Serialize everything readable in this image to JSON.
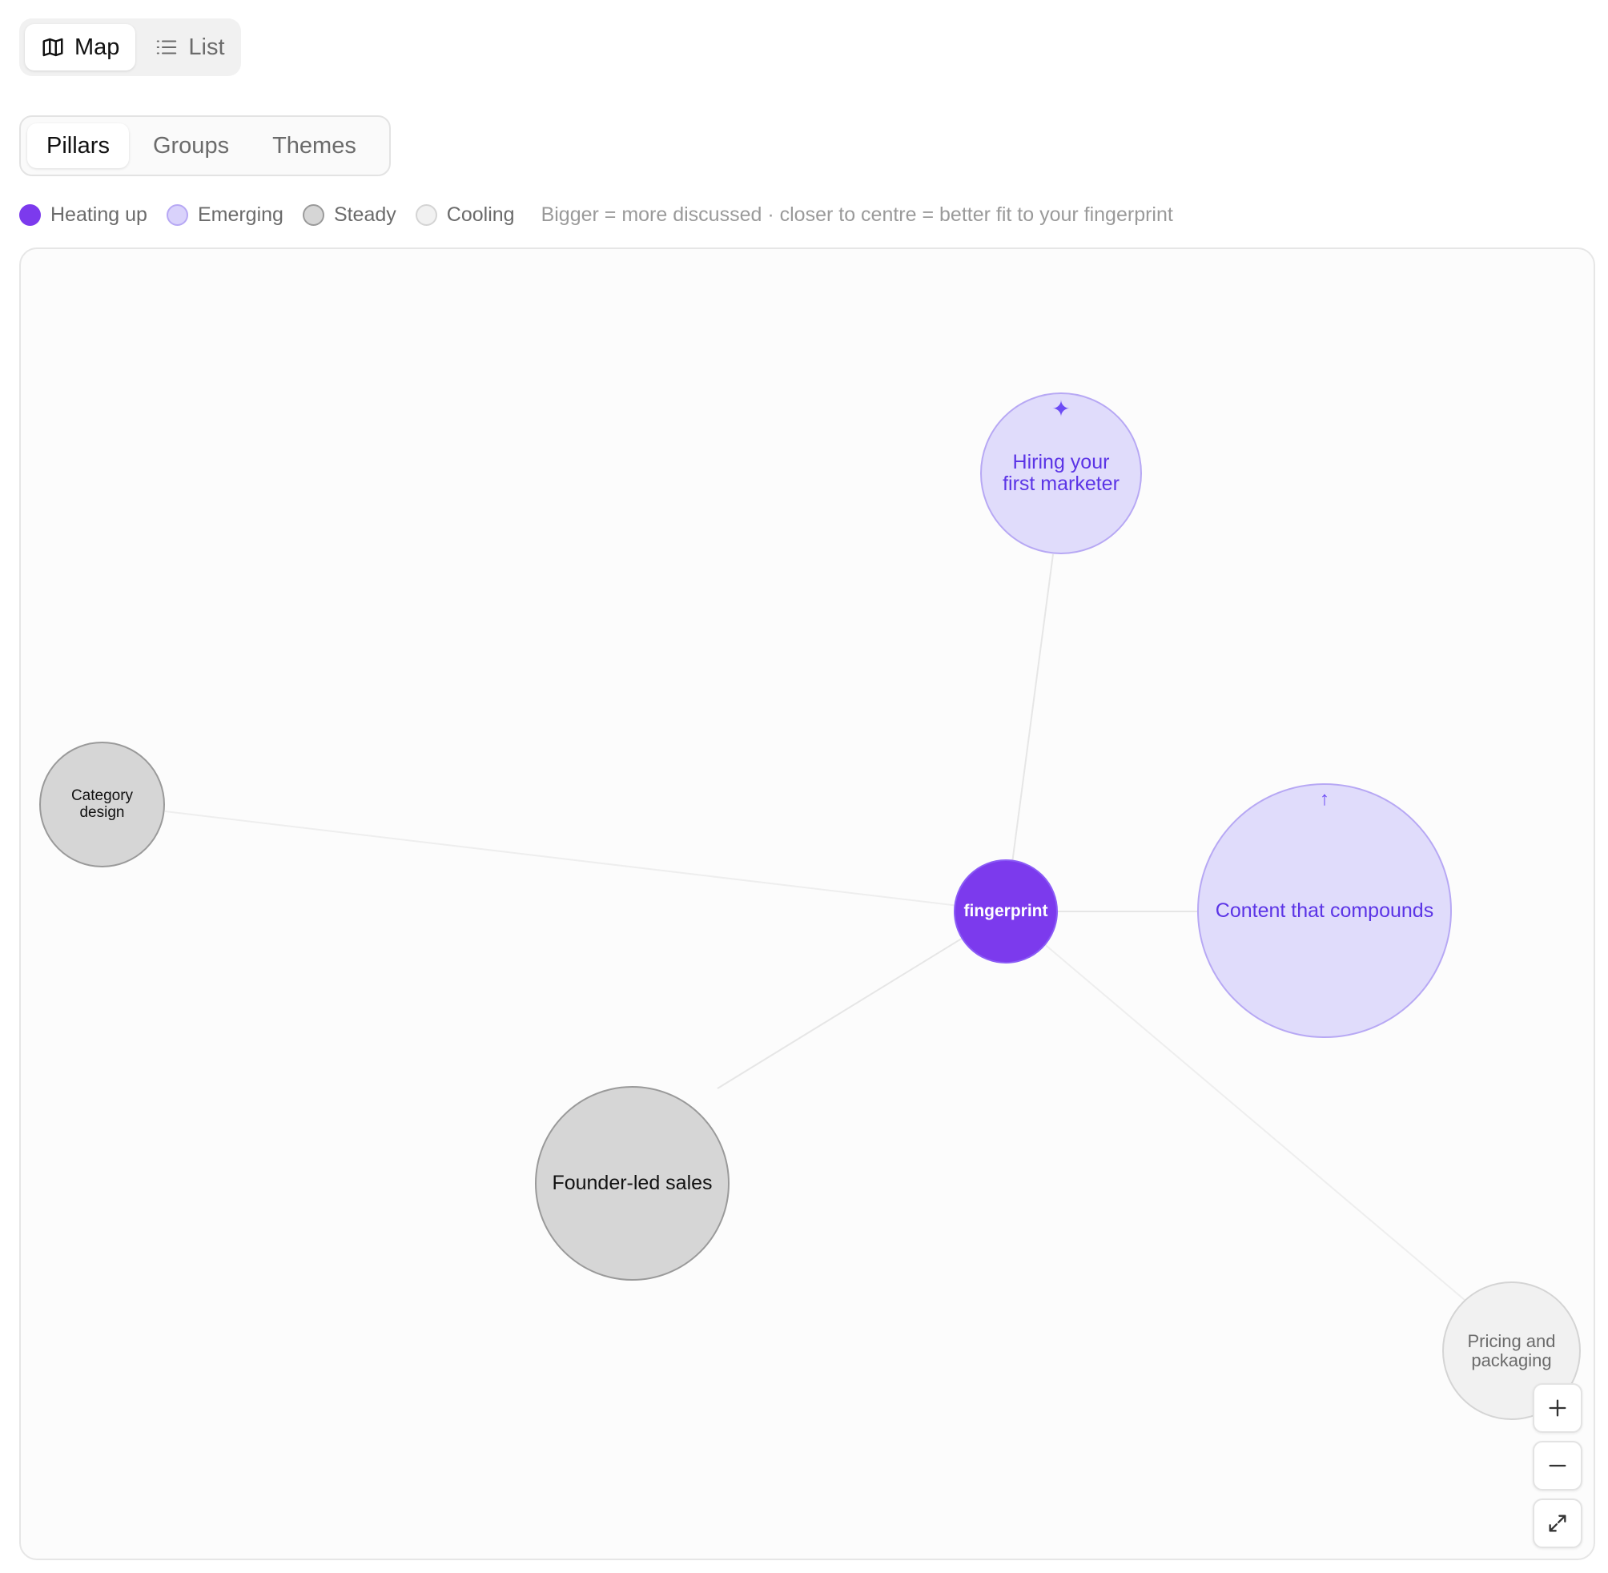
{
  "view_toggle": {
    "map": {
      "label": "Map",
      "icon": "map-icon",
      "active": true
    },
    "list": {
      "label": "List",
      "icon": "list-icon",
      "active": false
    }
  },
  "level_tabs": [
    {
      "label": "Pillars",
      "active": true
    },
    {
      "label": "Groups",
      "active": false
    },
    {
      "label": "Themes",
      "active": false
    }
  ],
  "legend": {
    "items": [
      {
        "label": "Heating up",
        "color": "#7c3aed"
      },
      {
        "label": "Emerging",
        "color": "#d9d2fb"
      },
      {
        "label": "Steady",
        "color": "#d6d6d6"
      },
      {
        "label": "Cooling",
        "color": "#f1f1f1"
      }
    ],
    "note": "Bigger = more discussed · closer to centre = better fit to your fingerprint"
  },
  "map": {
    "center": {
      "label": "fingerprint",
      "status": "Heating up"
    },
    "nodes": {
      "hiring": {
        "label_line1": "Hiring your",
        "label_line2": "first marketer",
        "status": "Emerging",
        "marker": "✦",
        "marker_icon": "sparkle-icon"
      },
      "content": {
        "label": "Content that compounds",
        "status": "Emerging",
        "marker": "↑",
        "marker_icon": "arrow-up-icon"
      },
      "founder": {
        "label": "Founder-led sales",
        "status": "Steady"
      },
      "category": {
        "label_line1": "Category",
        "label_line2": "design",
        "status": "Steady"
      },
      "pricing": {
        "label_line1": "Pricing and",
        "label_line2": "packaging",
        "status": "Cooling"
      }
    },
    "link_color": "#e6e6e6"
  },
  "zoom_controls": {
    "zoom_in_icon": "plus-icon",
    "zoom_out_icon": "minus-icon",
    "fit_icon": "expand-icon"
  }
}
